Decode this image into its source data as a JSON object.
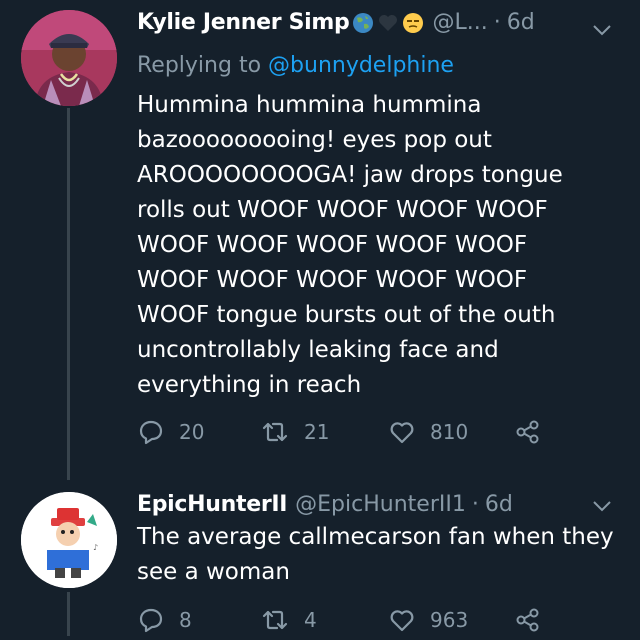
{
  "tweets": [
    {
      "display_name": "Kylie Jenner Simp",
      "name_emojis": [
        "globe-emoji",
        "white-heart-emoji",
        "unamused-face-emoji"
      ],
      "handle": "@L...",
      "separator": "·",
      "time": "6d",
      "replying_prefix": "Replying to ",
      "replying_to": "@bunnydelphine",
      "text_lines": [
        "Hummina hummina hummina",
        "bazooooooooing! eyes pop out",
        "AROOOOOOOOGA! jaw drops tongue",
        "rolls out WOOF WOOF WOOF WOOF",
        "WOOF WOOF WOOF WOOF WOOF",
        "WOOF WOOF WOOF WOOF WOOF",
        "WOOF tongue bursts out of the outh",
        "uncontrollably leaking face and",
        "everything in reach"
      ],
      "replies": "20",
      "retweets": "21",
      "likes": "810"
    },
    {
      "display_name": "EpicHunterII",
      "handle": "@EpicHunterII1",
      "separator": "·",
      "time": "6d",
      "text_lines": [
        "The average callmecarson fan when they",
        "see a woman"
      ],
      "replies": "8",
      "retweets": "4",
      "likes": "963"
    }
  ],
  "colors": {
    "background": "#15202b",
    "text": "#ffffff",
    "muted": "#8899a6",
    "link": "#1da1f2",
    "thread_line": "#38444d"
  }
}
